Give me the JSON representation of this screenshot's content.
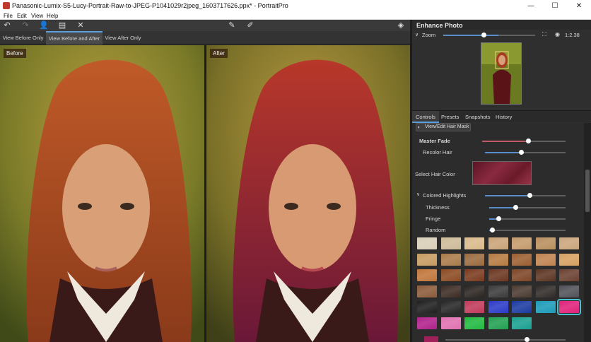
{
  "window": {
    "title": "Panasonic-Lumix-S5-Lucy-Portrait-Raw-to-JPEG-P1041029r2jpeg_1603717626.ppx* - PortraitPro",
    "buttons": {
      "minimize": "—",
      "maximize": "☐",
      "close": "✕"
    }
  },
  "menu": {
    "items": [
      "File",
      "Edit",
      "View",
      "Help"
    ]
  },
  "toolbar": {
    "icons": [
      "undo-icon",
      "redo-icon",
      "person-icon",
      "save-icon",
      "close-icon",
      "brush-add-icon",
      "brush-remove-icon",
      "layers-icon"
    ]
  },
  "view_tabs": [
    {
      "label": "View Before Only",
      "active": false
    },
    {
      "label": "View Before and After",
      "active": true
    },
    {
      "label": "View After Only",
      "active": false
    }
  ],
  "photos": {
    "before_label": "Before",
    "after_label": "After"
  },
  "right_panel": {
    "title": "Enhance Photo",
    "zoom": {
      "label": "Zoom",
      "value_text": "1:2.38",
      "level": 0.6
    }
  },
  "control_tabs": [
    {
      "label": "Controls",
      "active": true
    },
    {
      "label": "Presets",
      "active": false
    },
    {
      "label": "Snapshots",
      "active": false
    },
    {
      "label": "History",
      "active": false
    }
  ],
  "controls": {
    "hair_mask_button": "View/Edit Hair Mask",
    "master_fade": {
      "label": "Master Fade",
      "value": 0.55
    },
    "recolor_hair": {
      "label": "Recolor Hair",
      "value": 0.45
    },
    "select_hair_color": {
      "label": "Select Hair Color",
      "color": "#7a1f30"
    },
    "colored_highlights": {
      "label": "Colored Highlights",
      "value": 0.55
    },
    "thickness": {
      "label": "Thickness",
      "value": 0.35
    },
    "fringe": {
      "label": "Fringe",
      "value": 0.15
    },
    "random": {
      "label": "Random",
      "value": 0.05
    }
  },
  "hair_swatches": {
    "rows": [
      [
        "#d8cfb8",
        "#cdbb98",
        "#d9b98a",
        "#c9a377",
        "#c49a6c",
        "#b88e5d",
        "#caa57c"
      ],
      [
        "#c59a5f",
        "#a97a48",
        "#9a6a3e",
        "#b57a40",
        "#9c5e30",
        "#c08250",
        "#d7a060"
      ],
      [
        "#c0753a",
        "#8a4a22",
        "#7a3a1e",
        "#6b3620",
        "#7d4526",
        "#5c3422",
        "#6a4030"
      ],
      [
        "#8a5a3a",
        "#3b2a22",
        "#2a2420",
        "#3a3a3a",
        "#4a3a30",
        "#2f2a28",
        "#505058"
      ],
      [
        "#1e1e1e",
        "#262626",
        "#c03a5a",
        "#2a3ac8",
        "#1a3aa0",
        "#1a9ab8",
        "#e0207a"
      ],
      [
        "#b0208a",
        "#e070b0",
        "#20b840",
        "#20a050",
        "#18a090"
      ]
    ],
    "selected": {
      "row": 4,
      "col": 6
    }
  },
  "colors": {
    "accent": "#5aa0e0",
    "selection": "#48c0d0"
  }
}
